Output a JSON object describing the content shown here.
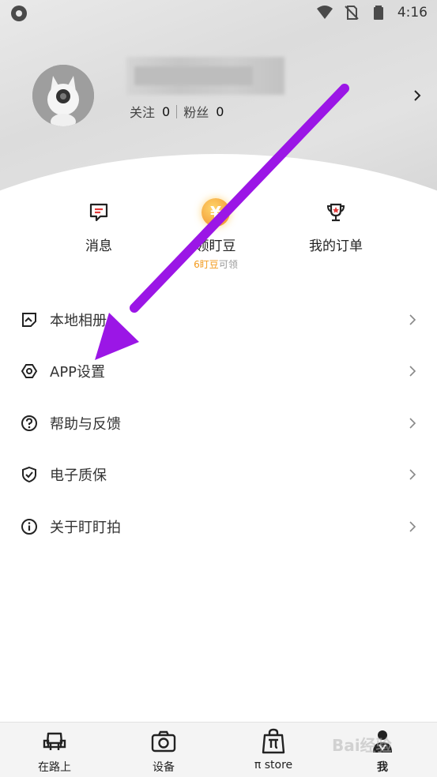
{
  "status_bar": {
    "time": "4:16"
  },
  "profile": {
    "follow_label": "关注",
    "follow_count": "0",
    "fans_label": "粉丝",
    "fans_count": "0"
  },
  "quick_actions": [
    {
      "label": "消息",
      "icon": "message-icon"
    },
    {
      "label": "领盯豆",
      "icon": "coin-icon",
      "coin_symbol": "¥",
      "sub_highlight": "6盯豆",
      "sub_suffix": "可领"
    },
    {
      "label": "我的订单",
      "icon": "trophy-icon"
    }
  ],
  "menu": [
    {
      "label": "本地相册",
      "icon": "album-icon"
    },
    {
      "label": "APP设置",
      "icon": "settings-icon"
    },
    {
      "label": "帮助与反馈",
      "icon": "help-icon"
    },
    {
      "label": "电子质保",
      "icon": "shield-icon"
    },
    {
      "label": "关于盯盯拍",
      "icon": "info-icon"
    }
  ],
  "bottom_nav": [
    {
      "label": "在路上",
      "icon": "car-seat-icon"
    },
    {
      "label": "设备",
      "icon": "camera-icon"
    },
    {
      "label": "π store",
      "icon": "shopping-bag-icon"
    },
    {
      "label": "我",
      "icon": "person-icon",
      "active": true
    }
  ],
  "annotation": {
    "arrow_color": "#9b16e6"
  },
  "watermark": {
    "text": "Bai经验"
  }
}
